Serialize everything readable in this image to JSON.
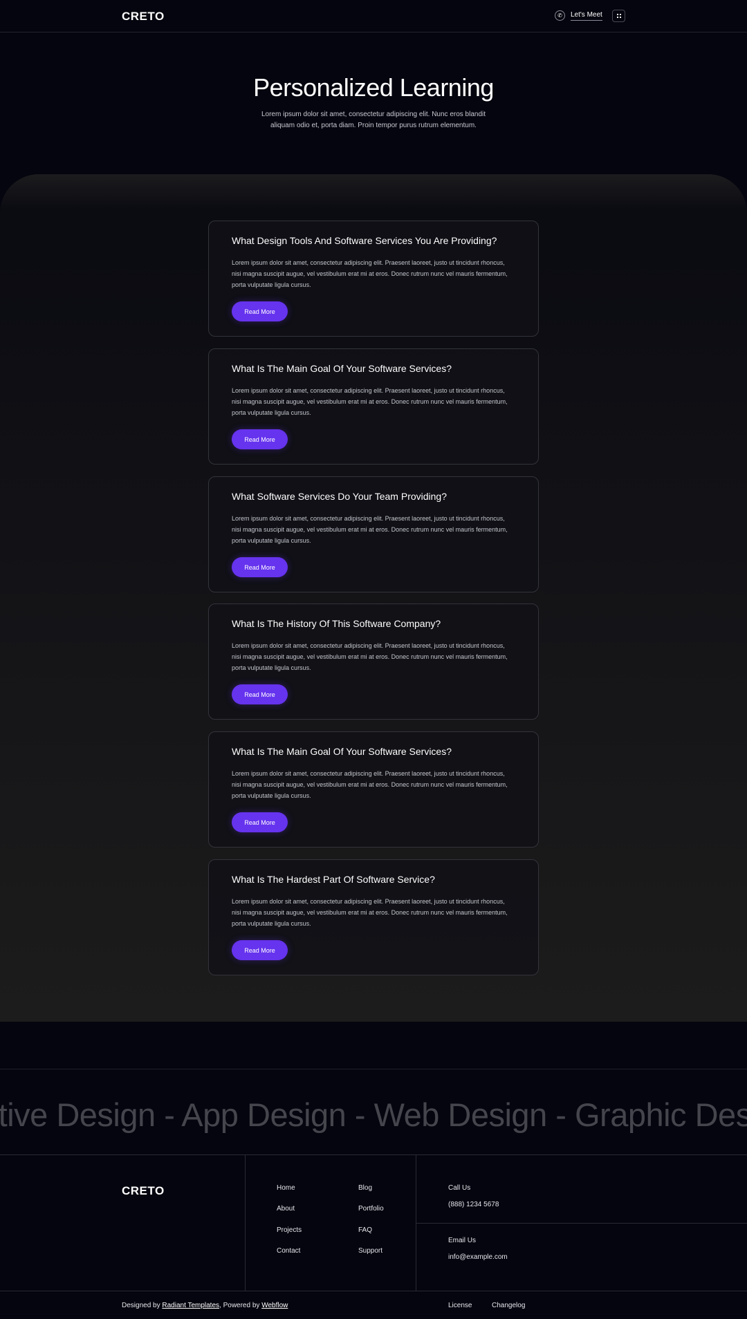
{
  "header": {
    "logo": "CRETO",
    "meet_label": "Let's Meet"
  },
  "hero": {
    "title": "Personalized Learning",
    "text": "Lorem ipsum dolor sit amet, consectetur adipiscing elit. Nunc eros blandit aliquam odio et, porta diam. Proin tempor purus rutrum elementum."
  },
  "cards": [
    {
      "title": "What Design Tools And Software Services You Are Providing?",
      "text": "Lorem ipsum dolor sit amet, consectetur adipiscing elit. Praesent laoreet, justo ut tincidunt rhoncus, nisi magna suscipit augue, vel vestibulum erat mi at eros. Donec rutrum nunc vel mauris fermentum, porta vulputate ligula cursus.",
      "button": "Read More"
    },
    {
      "title": "What Is The Main Goal Of Your Software Services?",
      "text": "Lorem ipsum dolor sit amet, consectetur adipiscing elit. Praesent laoreet, justo ut tincidunt rhoncus, nisi magna suscipit augue, vel vestibulum erat mi at eros. Donec rutrum nunc vel mauris fermentum, porta vulputate ligula cursus.",
      "button": "Read More"
    },
    {
      "title": "What Software Services Do Your Team Providing?",
      "text": "Lorem ipsum dolor sit amet, consectetur adipiscing elit. Praesent laoreet, justo ut tincidunt rhoncus, nisi magna suscipit augue, vel vestibulum erat mi at eros. Donec rutrum nunc vel mauris fermentum, porta vulputate ligula cursus.",
      "button": "Read More"
    },
    {
      "title": "What Is The History Of This Software Company?",
      "text": "Lorem ipsum dolor sit amet, consectetur adipiscing elit. Praesent laoreet, justo ut tincidunt rhoncus, nisi magna suscipit augue, vel vestibulum erat mi at eros. Donec rutrum nunc vel mauris fermentum, porta vulputate ligula cursus.",
      "button": "Read More"
    },
    {
      "title": "What Is The Main Goal Of Your Software Services?",
      "text": "Lorem ipsum dolor sit amet, consectetur adipiscing elit. Praesent laoreet, justo ut tincidunt rhoncus, nisi magna suscipit augue, vel vestibulum erat mi at eros. Donec rutrum nunc vel mauris fermentum, porta vulputate ligula cursus.",
      "button": "Read More"
    },
    {
      "title": "What Is The Hardest Part Of Software Service?",
      "text": "Lorem ipsum dolor sit amet, consectetur adipiscing elit. Praesent laoreet, justo ut tincidunt rhoncus, nisi magna suscipit augue, vel vestibulum erat mi at eros. Donec rutrum nunc vel mauris fermentum, porta vulputate ligula cursus.",
      "button": "Read More"
    }
  ],
  "marquee": {
    "text": "ative Design - App Design - Web Design - Graphic Design"
  },
  "footer": {
    "logo": "CRETO",
    "links_col1": [
      "Home",
      "About",
      "Projects",
      "Contact"
    ],
    "links_col2": [
      "Blog",
      "Portfolio",
      "FAQ",
      "Support"
    ],
    "call_label": "Call Us",
    "call_value": "(888) 1234 5678",
    "email_label": "Email Us",
    "email_value": "info@example.com",
    "designed_by_prefix": "Designed by ",
    "designed_by_link": "Radiant Templates",
    "powered_by_prefix": ", Powered by ",
    "powered_by_link": "Webflow",
    "license": "License",
    "changelog": "Changelog"
  },
  "colors": {
    "background": "#05050f",
    "accent": "#6633ee",
    "card_border": "#33333b"
  }
}
